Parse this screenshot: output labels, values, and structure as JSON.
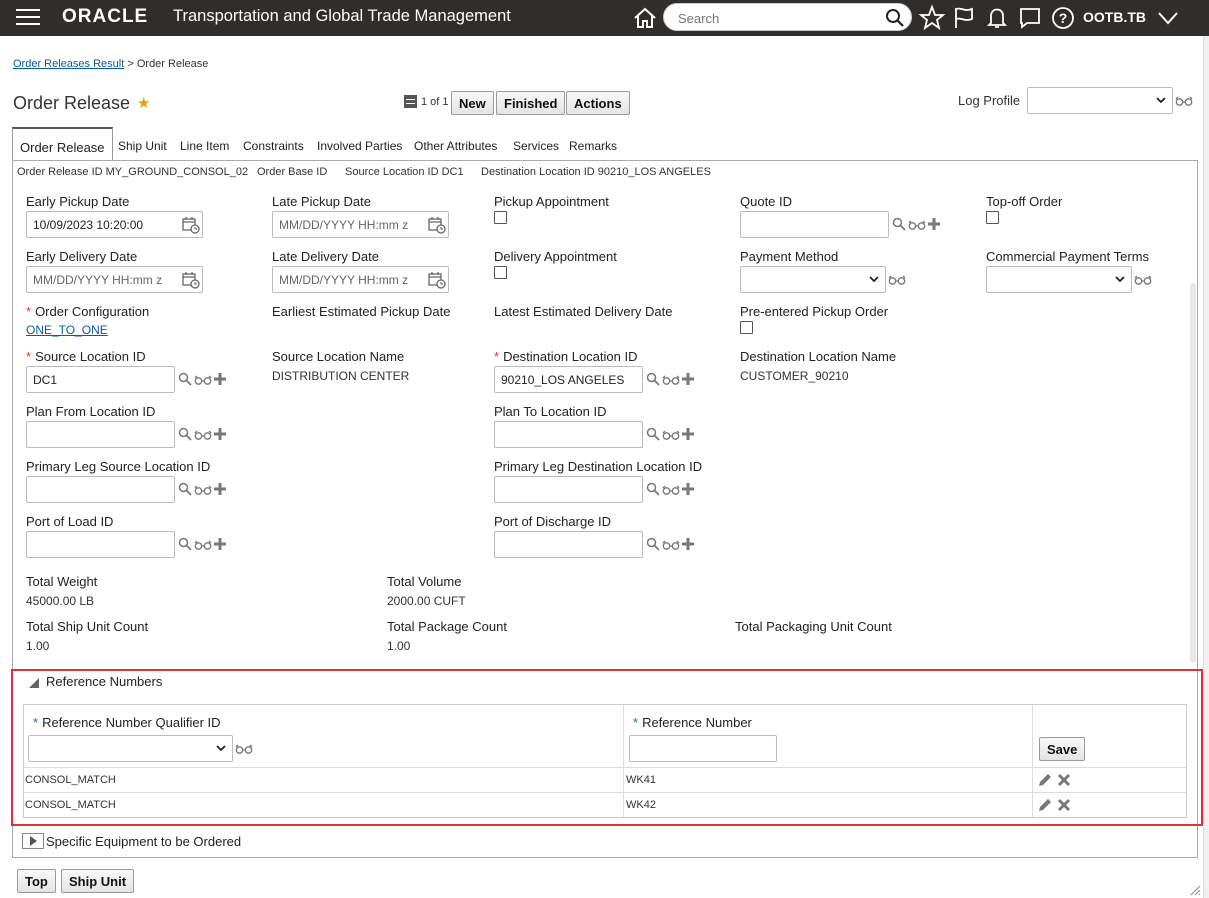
{
  "header": {
    "brand": "ORACLE",
    "app_title": "Transportation and Global Trade Management",
    "search_placeholder": "Search",
    "user": "OOTB.TB"
  },
  "breadcrumb": {
    "parent": "Order Releases Result",
    "separator": ">",
    "current": "Order Release"
  },
  "page": {
    "title": "Order Release"
  },
  "toolbar": {
    "pager": "1 of 1",
    "new_label": "New",
    "finished_label": "Finished",
    "actions_label": "Actions",
    "log_profile_label": "Log Profile",
    "log_profile_value": ""
  },
  "tabs": [
    "Order Release",
    "Ship Unit",
    "Line Item",
    "Constraints",
    "Involved Parties",
    "Other Attributes",
    "Services",
    "Remarks"
  ],
  "info": {
    "order_release_id": "Order Release ID MY_GROUND_CONSOL_02",
    "order_base_id": "Order Base ID",
    "source_location_id": "Source Location ID DC1",
    "destination_location_id": "Destination Location ID 90210_LOS ANGELES"
  },
  "fields": {
    "early_pickup_date": {
      "label": "Early Pickup Date",
      "value": "10/09/2023 10:20:00"
    },
    "late_pickup_date": {
      "label": "Late Pickup Date",
      "placeholder": "MM/DD/YYYY HH:mm z"
    },
    "pickup_appointment": {
      "label": "Pickup Appointment"
    },
    "quote_id": {
      "label": "Quote ID",
      "value": ""
    },
    "top_off_order": {
      "label": "Top-off Order"
    },
    "early_delivery_date": {
      "label": "Early Delivery Date",
      "placeholder": "MM/DD/YYYY HH:mm z"
    },
    "late_delivery_date": {
      "label": "Late Delivery Date",
      "placeholder": "MM/DD/YYYY HH:mm z"
    },
    "delivery_appointment": {
      "label": "Delivery Appointment"
    },
    "payment_method": {
      "label": "Payment Method",
      "value": ""
    },
    "commercial_payment_terms": {
      "label": "Commercial Payment Terms",
      "value": ""
    },
    "order_configuration": {
      "label": "Order Configuration",
      "value": "ONE_TO_ONE"
    },
    "earliest_estimated_pickup_date": {
      "label": "Earliest Estimated Pickup Date"
    },
    "latest_estimated_delivery_date": {
      "label": "Latest Estimated Delivery Date"
    },
    "pre_entered_pickup_order": {
      "label": "Pre-entered Pickup Order"
    },
    "source_location_id": {
      "label": "Source Location ID",
      "value": "DC1"
    },
    "source_location_name": {
      "label": "Source Location Name",
      "value": "DISTRIBUTION CENTER"
    },
    "destination_location_id": {
      "label": "Destination Location ID",
      "value": "90210_LOS ANGELES"
    },
    "destination_location_name": {
      "label": "Destination Location Name",
      "value": "CUSTOMER_90210"
    },
    "plan_from_location_id": {
      "label": "Plan From Location ID",
      "value": ""
    },
    "plan_to_location_id": {
      "label": "Plan To Location ID",
      "value": ""
    },
    "primary_leg_source_location_id": {
      "label": "Primary Leg Source Location ID",
      "value": ""
    },
    "primary_leg_destination_location_id": {
      "label": "Primary Leg Destination Location ID",
      "value": ""
    },
    "port_of_load_id": {
      "label": "Port of Load ID",
      "value": ""
    },
    "port_of_discharge_id": {
      "label": "Port of Discharge ID",
      "value": ""
    },
    "total_weight": {
      "label": "Total Weight",
      "value": "45000.00 LB"
    },
    "total_volume": {
      "label": "Total Volume",
      "value": "2000.00 CUFT"
    },
    "total_ship_unit_count": {
      "label": "Total Ship Unit Count",
      "value": "1.00"
    },
    "total_package_count": {
      "label": "Total Package Count",
      "value": "1.00"
    },
    "total_packaging_unit_count": {
      "label": "Total Packaging Unit Count"
    }
  },
  "reference_numbers": {
    "title": "Reference Numbers",
    "col_qualifier": "Reference Number Qualifier ID",
    "col_number": "Reference Number",
    "save_label": "Save",
    "rows": [
      {
        "qualifier": "CONSOL_MATCH",
        "number": "WK41"
      },
      {
        "qualifier": "CONSOL_MATCH",
        "number": "WK42"
      }
    ]
  },
  "specific_equipment": {
    "title": "Specific Equipment to be Ordered"
  },
  "bottom": {
    "top_label": "Top",
    "ship_unit_label": "Ship Unit"
  }
}
